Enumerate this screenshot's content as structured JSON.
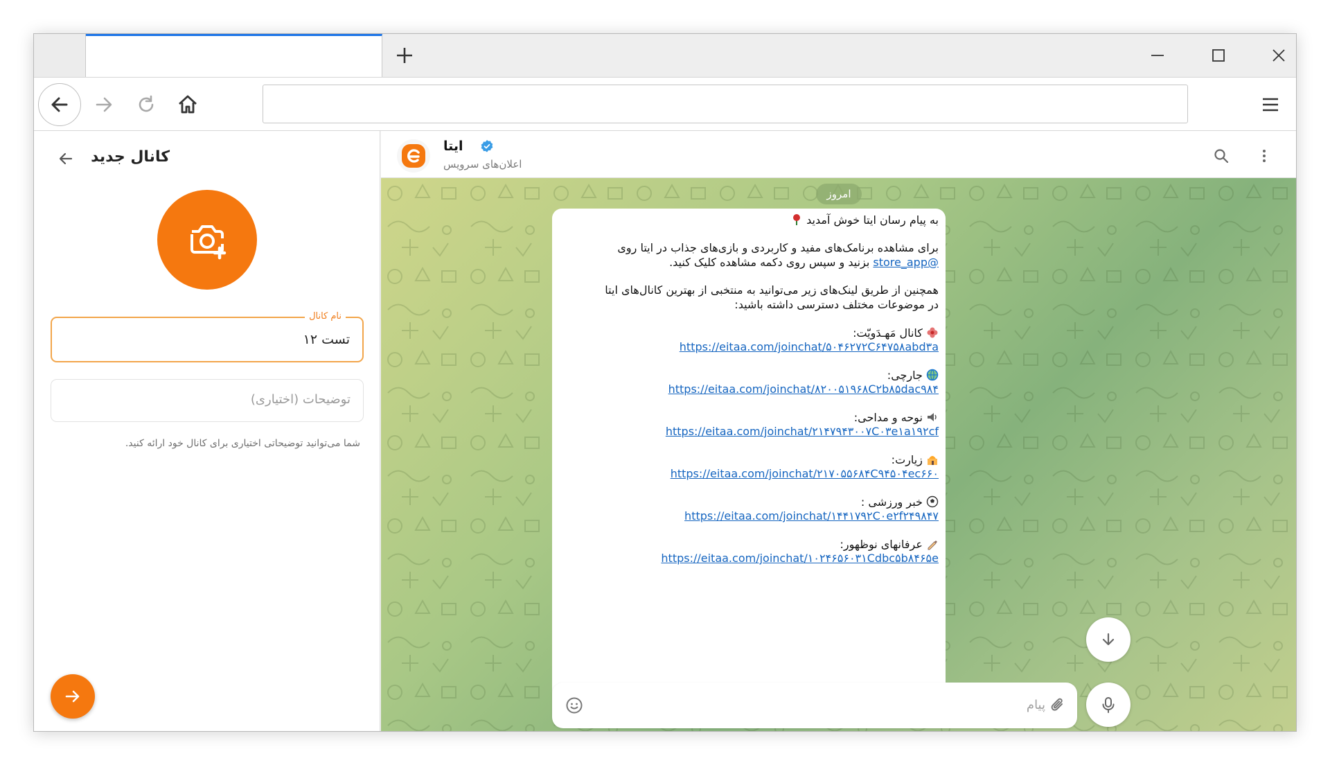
{
  "browser": {
    "icons": {
      "new_tab": "plus-icon",
      "minimize": "minimize-icon",
      "maximize": "maximize-icon",
      "close": "close-icon",
      "back": "arrow-left-icon",
      "forward": "arrow-right-icon",
      "reload": "reload-icon",
      "home": "home-icon",
      "menu": "hamburger-menu-icon"
    },
    "accent": "#1a73e8"
  },
  "left_panel": {
    "title": "کانال جدید",
    "name_field": {
      "label": "نام کانال",
      "value": "تست ۱۲"
    },
    "description_field": {
      "placeholder": "توضیحات (اختیاری)"
    },
    "hint": "شما می‌توانید توضیحاتی اختیاری برای کانال خود ارائه کنید.",
    "accent": "#f5780f"
  },
  "chat": {
    "channel_name": "ایتا",
    "channel_subtitle": "اعلان‌های سرویس",
    "verified": true,
    "date_chip": "امروز",
    "message": {
      "line1": "به پیام رسان ایتا خوش آمدید",
      "line2": "برای مشاهده برنامک‌های مفید و کاربردی و بازی‌های جذاب در ایتا روی",
      "line3_link": "@store_app",
      "line3_text": "بزنید و سپس روی دکمه مشاهده کلیک کنید.",
      "line4": "همچنین از طریق لینک‌های زیر می‌توانید به منتخبی از بهترین کانال‌های ایتا",
      "line5": "در موضوعات مختلف دسترسی داشته باشید:",
      "items": [
        {
          "label": "کانال مَهـدَویّت:",
          "link": "https://eitaa.com/joinchat/۵۰۴۶۲۷۲C۶۴۷۵۸abd۳a",
          "emoji": "flower"
        },
        {
          "label": "جارچی:",
          "link": "https://eitaa.com/joinchat/۸۲۰۰۵۱۹۶۸C۲b۸۵dac۹۸۴",
          "emoji": "globe"
        },
        {
          "label": "نوحه و مداحی:",
          "link": "https://eitaa.com/joinchat/۲۱۴۷۹۴۳۰۰۷C۰۳e۱a۱۹۲cf",
          "emoji": "speaker"
        },
        {
          "label": "زیارت:",
          "link": "https://eitaa.com/joinchat/۲۱۷۰۵۵۶۸۴C۹۴۵۰۴ec۶۶۰",
          "emoji": "shrine"
        },
        {
          "label": "خبر ورزشی :",
          "link": "https://eitaa.com/joinchat/۱۴۴۱۷۹۲C۰e۲f۲۴۹۸۴۷",
          "emoji": "soccer"
        },
        {
          "label": "عرفانهای نوظهور:",
          "link": "https://eitaa.com/joinchat/۱۰۲۴۶۵۶۰۳۱Cdbc۵b۸۴۶۵e",
          "emoji": "writing-hand"
        }
      ]
    },
    "composer": {
      "placeholder": "پیام"
    }
  }
}
